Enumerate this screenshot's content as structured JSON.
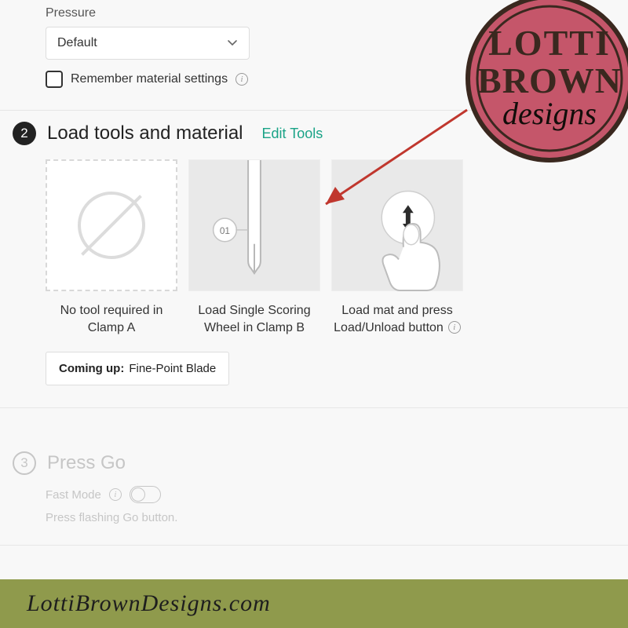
{
  "pressure": {
    "label": "Pressure",
    "value": "Default",
    "remember_label": "Remember material settings"
  },
  "step2": {
    "number": "2",
    "title": "Load tools and material",
    "edit_link": "Edit Tools",
    "card_a_caption_l1": "No tool required in",
    "card_a_caption_l2": "Clamp A",
    "card_b_caption_l1": "Load Single Scoring",
    "card_b_caption_l2": "Wheel in Clamp B",
    "card_b_badge": "01",
    "card_c_caption_l1": "Load mat and press",
    "card_c_caption_l2": "Load/Unload button",
    "coming_up_label": "Coming up:",
    "coming_up_value": "Fine-Point Blade"
  },
  "step3": {
    "number": "3",
    "title": "Press Go",
    "fast_mode_label": "Fast Mode",
    "hint": "Press flashing Go button."
  },
  "logo": {
    "line1": "LOTTI",
    "line2": "BROWN",
    "line3": "designs"
  },
  "footer": {
    "url": "LottiBrownDesigns.com"
  }
}
